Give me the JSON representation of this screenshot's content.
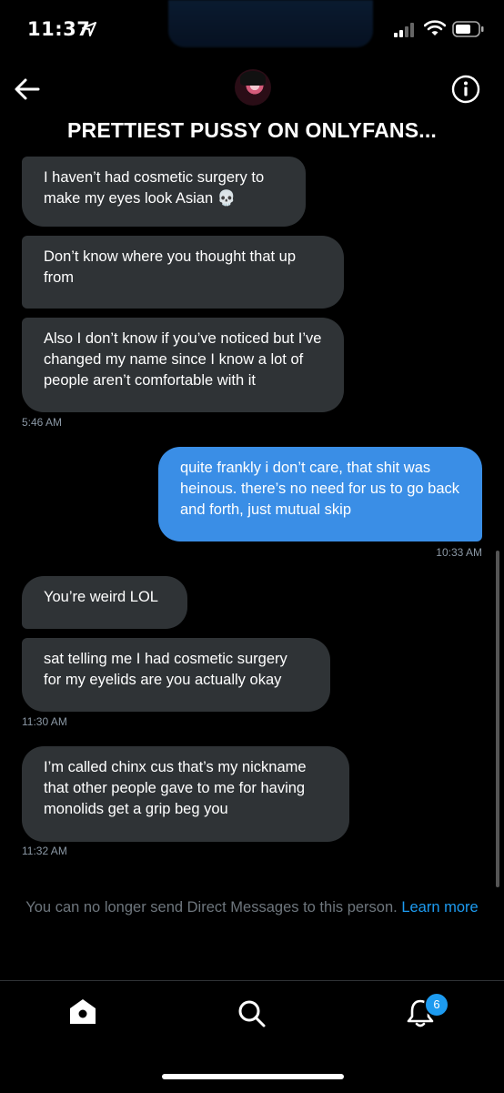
{
  "status_bar": {
    "time": "11:37"
  },
  "header": {
    "title": "PRETTIEST PUSSY ON ONLYFANS..."
  },
  "messages": [
    {
      "text": "I haven’t had cosmetic surgery to make my eyes look Asian 💀"
    },
    {
      "text": "Don’t know where you thought that up from"
    },
    {
      "text": "Also I don’t know if you’ve noticed but I’ve changed my name since I know a lot of people aren’t comfortable with it"
    },
    {
      "text": "quite frankly i don’t care, that shit was heinous. there’s no need for us to go back and forth, just mutual skip"
    },
    {
      "text": "You’re weird LOL"
    },
    {
      "text": "sat telling me I had cosmetic surgery for my eyelids are you actually okay"
    },
    {
      "text": "I’m called chinx cus that’s my nickname that other people gave to me for having monolids get a grip beg you"
    }
  ],
  "timestamps": [
    "5:46 AM",
    "10:33 AM",
    "11:30 AM",
    "11:32 AM"
  ],
  "notice": {
    "text": "You can no longer send Direct Messages to this person.",
    "link": "Learn more"
  },
  "nav": {
    "icons": [
      "home-icon",
      "search-icon",
      "bell-icon"
    ],
    "notification_count": "6"
  },
  "colors": {
    "incoming_bubble": "#2f3336",
    "outgoing_bubble": "#3a8ee6",
    "link": "#1d9bf0"
  }
}
